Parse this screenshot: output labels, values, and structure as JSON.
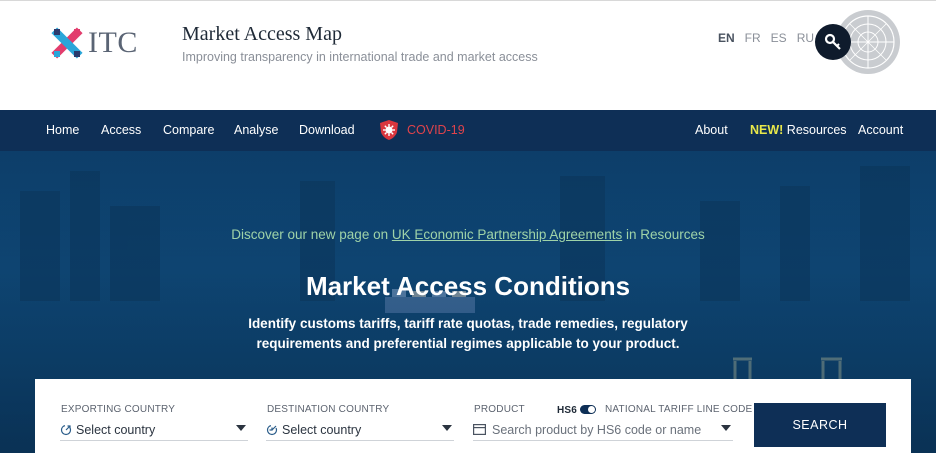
{
  "header": {
    "logo_text": "ITC",
    "title": "Market Access Map",
    "subtitle": "Improving transparency in international trade and market access",
    "languages": [
      "EN",
      "FR",
      "ES",
      "RU"
    ],
    "active_language": "EN"
  },
  "nav": {
    "left": [
      "Home",
      "Access",
      "Compare",
      "Analyse",
      "Download"
    ],
    "covid": "COVID-19",
    "right_about": "About",
    "new_tag": "NEW!",
    "resources": " Resources",
    "account": "Account"
  },
  "hero": {
    "announce_prefix": "Discover our new page on ",
    "announce_link": "UK Economic Partnership Agreements",
    "announce_suffix": " in Resources",
    "title": "Market Access Conditions",
    "description": "Identify customs tariffs, tariff rate quotas, trade remedies, regulatory requirements and preferential regimes applicable to your product."
  },
  "search": {
    "exporting_label": "EXPORTING COUNTRY",
    "exporting_value": "Select country",
    "destination_label": "DESTINATION COUNTRY",
    "destination_value": "Select country",
    "product_label": "PRODUCT",
    "hs6_label": "HS6",
    "national_label": "NATIONAL TARIFF LINE CODE",
    "product_placeholder": "Search product by HS6 code or name",
    "search_button": "SEARCH"
  },
  "colors": {
    "nav_bg": "#0e2f56",
    "covid": "#e0434b",
    "new_tag": "#e8e84a",
    "announce": "#9fd3a8"
  }
}
